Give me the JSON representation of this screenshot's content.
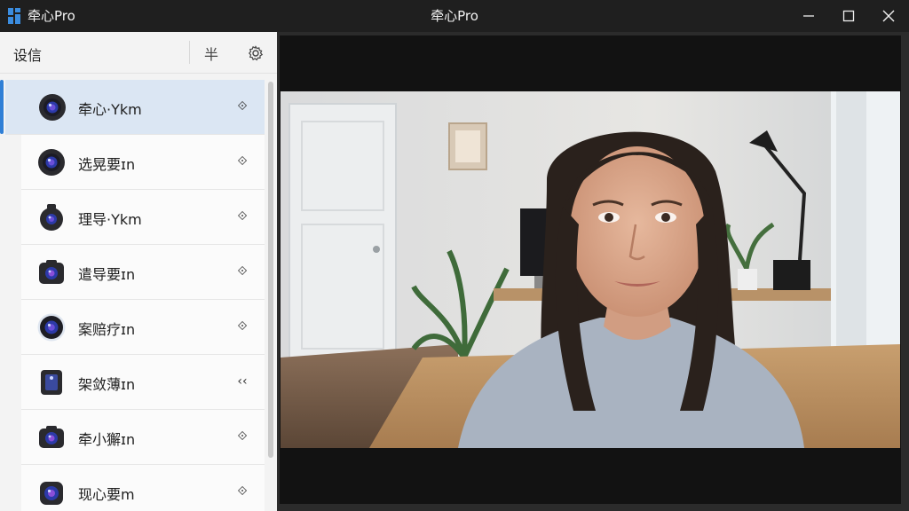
{
  "window": {
    "app_name": "牵心Pro",
    "title": "牵心Pro",
    "controls": [
      "minimize",
      "maximize",
      "close"
    ]
  },
  "sidebar": {
    "header": "设信",
    "header_button_glyph": "半",
    "settings_icon": "gear-icon",
    "items": [
      {
        "label": "牵心·Ykm",
        "icon": "camera-icon",
        "action_icon": "diamond-arrows-icon",
        "selected": true
      },
      {
        "label": "选晃要ɪn",
        "icon": "camera-icon",
        "action_icon": "diamond-arrows-icon",
        "selected": false
      },
      {
        "label": "理导·Ykm",
        "icon": "camera-icon",
        "action_icon": "diamond-arrows-icon",
        "selected": false
      },
      {
        "label": "遣导要ɪn",
        "icon": "camera-icon",
        "action_icon": "diamond-arrows-icon",
        "selected": false
      },
      {
        "label": "案赔疗ɪn",
        "icon": "camera-icon",
        "action_icon": "diamond-arrows-icon",
        "selected": false
      },
      {
        "label": "架敛薄ɪn",
        "icon": "phone-camera-icon",
        "action_icon": "chevrons-left-icon",
        "selected": false
      },
      {
        "label": "牵小獬ɪn",
        "icon": "camera-icon",
        "action_icon": "diamond-arrows-icon",
        "selected": false
      },
      {
        "label": "现心要m",
        "icon": "camera-icon",
        "action_icon": "diamond-arrows-icon",
        "selected": false
      }
    ]
  },
  "colors": {
    "accent": "#2f7fd6",
    "selected_bg": "#dbe6f3",
    "titlebar_bg": "#1f1f1f"
  }
}
